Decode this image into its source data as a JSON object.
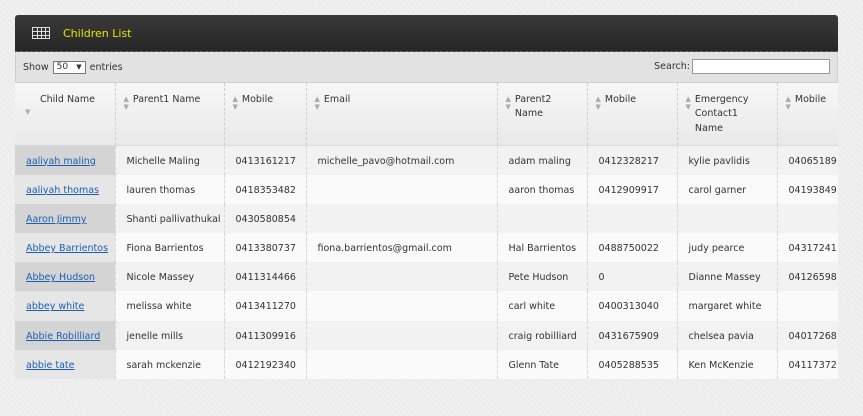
{
  "header": {
    "title": "Children List"
  },
  "toolbar": {
    "show_label": "Show",
    "length_value": "50",
    "entries_label": "entries",
    "search_label": "Search:"
  },
  "columns": [
    {
      "label": "Child Name"
    },
    {
      "label": "Parent1 Name"
    },
    {
      "label": "Mobile"
    },
    {
      "label": "Email"
    },
    {
      "label": "Parent2 Name"
    },
    {
      "label": "Mobile"
    },
    {
      "label": "Emergency Contact1 Name"
    },
    {
      "label": "Mobile"
    }
  ],
  "rows": [
    {
      "child": "aaliyah maling",
      "p1": "Michelle Maling",
      "m1": "0413161217",
      "email": "michelle_pavo@hotmail.com",
      "p2": "adam maling",
      "m2": "0412328217",
      "ec": "kylie pavlidis",
      "m3": "04065189"
    },
    {
      "child": "aaliyah thomas",
      "p1": "lauren thomas",
      "m1": "0418353482",
      "email": "",
      "p2": "aaron thomas",
      "m2": "0412909917",
      "ec": "carol garner",
      "m3": "04193849"
    },
    {
      "child": "Aaron Jimmy",
      "p1": "Shanti pallivathukal",
      "m1": "0430580854",
      "email": "",
      "p2": "",
      "m2": "",
      "ec": "",
      "m3": ""
    },
    {
      "child": "Abbey Barrientos",
      "p1": "Fiona Barrientos",
      "m1": "0413380737",
      "email": "fiona.barrientos@gmail.com",
      "p2": "Hal Barrientos",
      "m2": "0488750022",
      "ec": "judy pearce",
      "m3": "04317241"
    },
    {
      "child": "Abbey Hudson",
      "p1": "Nicole Massey",
      "m1": "0411314466",
      "email": "",
      "p2": "Pete Hudson",
      "m2": "0",
      "ec": "Dianne Massey",
      "m3": "04126598"
    },
    {
      "child": "abbey white",
      "p1": "melissa white",
      "m1": "0413411270",
      "email": "",
      "p2": "carl white",
      "m2": "0400313040",
      "ec": "margaret white",
      "m3": ""
    },
    {
      "child": "Abbie Robilliard",
      "p1": "jenelle mills",
      "m1": "0411309916",
      "email": "",
      "p2": "craig robilliard",
      "m2": "0431675909",
      "ec": "chelsea pavia",
      "m3": "04017268"
    },
    {
      "child": "abbie tate",
      "p1": "sarah mckenzie",
      "m1": "0412192340",
      "email": "",
      "p2": "Glenn Tate",
      "m2": "0405288535",
      "ec": "Ken McKenzie",
      "m3": "04117372"
    }
  ]
}
